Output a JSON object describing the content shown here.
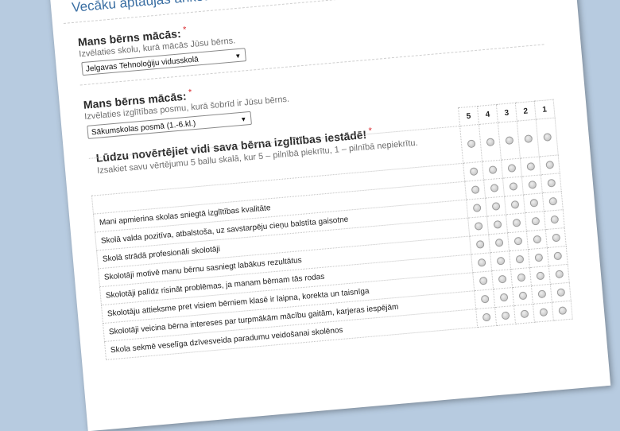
{
  "form": {
    "title": "Vecāku aptaujas anketa"
  },
  "q1": {
    "label": "Mans bērns mācās:",
    "required": "*",
    "hint": "Izvēlaties skolu, kurā mācās Jūsu bērns.",
    "selected": "Jelgavas Tehnoloģiju vidusskolā",
    "arrow": "▼"
  },
  "q2": {
    "label": "Mans bērns mācās:",
    "required": "*",
    "hint": "Izvēlaties izglītības posmu, kurā šobrīd ir Jūsu bērns.",
    "selected": "Sākumskolas posmā (1.-6.kl.)",
    "arrow": "▼"
  },
  "q3": {
    "label": "Lūdzu novērtējiet vidi sava bērna izglītības iestādē!",
    "required": "*",
    "hint": "Izsakiet savu vērtējumu 5 ballu skalā, kur 5 – pilnībā piekrītu, 1 – pilnībā nepiekrītu.",
    "scale": [
      "5",
      "4",
      "3",
      "2",
      "1"
    ],
    "statements": [
      "",
      "Mani apmierina skolas sniegtā izglītības kvalitāte",
      "Skolā valda pozitīva, atbalstoša, uz savstarpēju cieņu balstīta gaisotne",
      "Skolā strādā profesionāli skolotāji",
      "Skolotāji motivē manu bērnu sasniegt labākus rezultātus",
      "Skolotāji palīdz risināt problēmas, ja manam bērnam tās rodas",
      "Skolotāju attieksme pret visiem bērniem klasē ir laipna, korekta un taisnīga",
      "Skolotāji veicina bērna intereses par turpmākām mācību gaitām, karjeras iespējām",
      "Skola sekmē veselīga dzīvesveida paradumu veidošanai skolēnos"
    ]
  }
}
